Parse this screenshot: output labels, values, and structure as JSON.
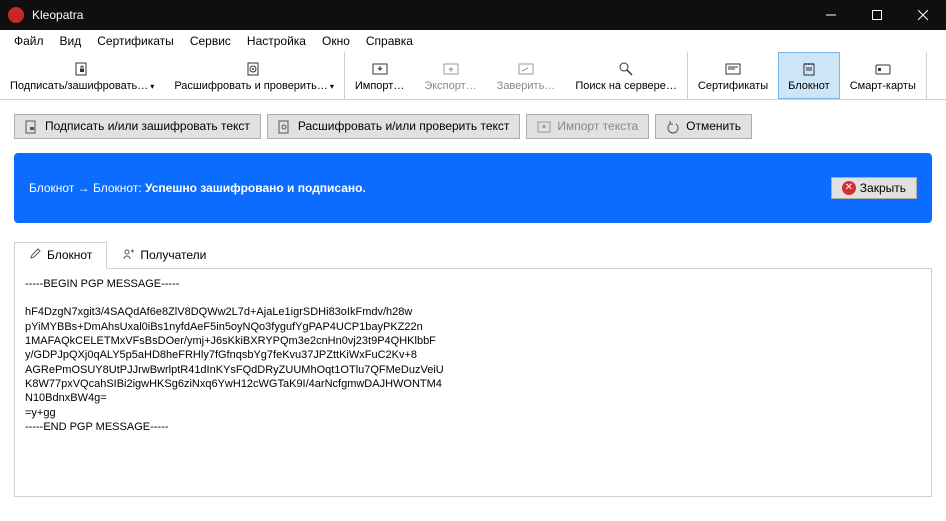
{
  "window": {
    "title": "Kleopatra"
  },
  "menubar": {
    "items": [
      "Файл",
      "Вид",
      "Сертификаты",
      "Сервис",
      "Настройка",
      "Окно",
      "Справка"
    ]
  },
  "toolbar": {
    "sign": "Подписать/зашифровать…",
    "decrypt": "Расшифровать и проверить…",
    "import": "Импорт…",
    "export": "Экспорт…",
    "certify": "Заверить…",
    "search": "Поиск на сервере…",
    "certs": "Сертификаты",
    "notepad": "Блокнот",
    "smart": "Смарт-карты"
  },
  "actions": {
    "sign_text": "Подписать и/или зашифровать текст",
    "decrypt_text": "Расшифровать и/или проверить текст",
    "import_text": "Импорт текста",
    "undo": "Отменить"
  },
  "banner": {
    "path": "Блокнот → Блокнот:",
    "status": "Успешно зашифровано и подписано.",
    "close": "Закрыть"
  },
  "tabs": {
    "notepad": "Блокнот",
    "recipients": "Получатели"
  },
  "message": "-----BEGIN PGP MESSAGE-----\n\nhF4DzgN7xgit3/4SAQdAf6e8ZlV8DQWw2L7d+AjaLe1igrSDHi83oIkFmdv/h28w\npYiMYBBs+DmAhsUxal0iBs1nyfdAeF5in5oyNQo3fygufYgPAP4UCP1bayPKZ22n\n1MAFAQkCELETMxVFsBsDOer/ymj+J6sKkiBXRYPQm3e2cnHn0vj23t9P4QHKlbbF\ny/GDPJpQXj0qALY5p5aHD8heFRHly7fGfnqsbYg7feKvu37JPZttKiWxFuC2Kv+8\nAGRePmOSUY8UtPJJrwBwrlptR41dInKYsFQdDRyZUUMhOqt1OTlu7QFMeDuzVeiU\nK8W77pxVQcahSIBi2igwHKSg6ziNxq6YwH12cWGTaK9I/4arNcfgmwDAJHWONTM4\nN10BdnxBW4g=\n=y+gg\n-----END PGP MESSAGE-----"
}
